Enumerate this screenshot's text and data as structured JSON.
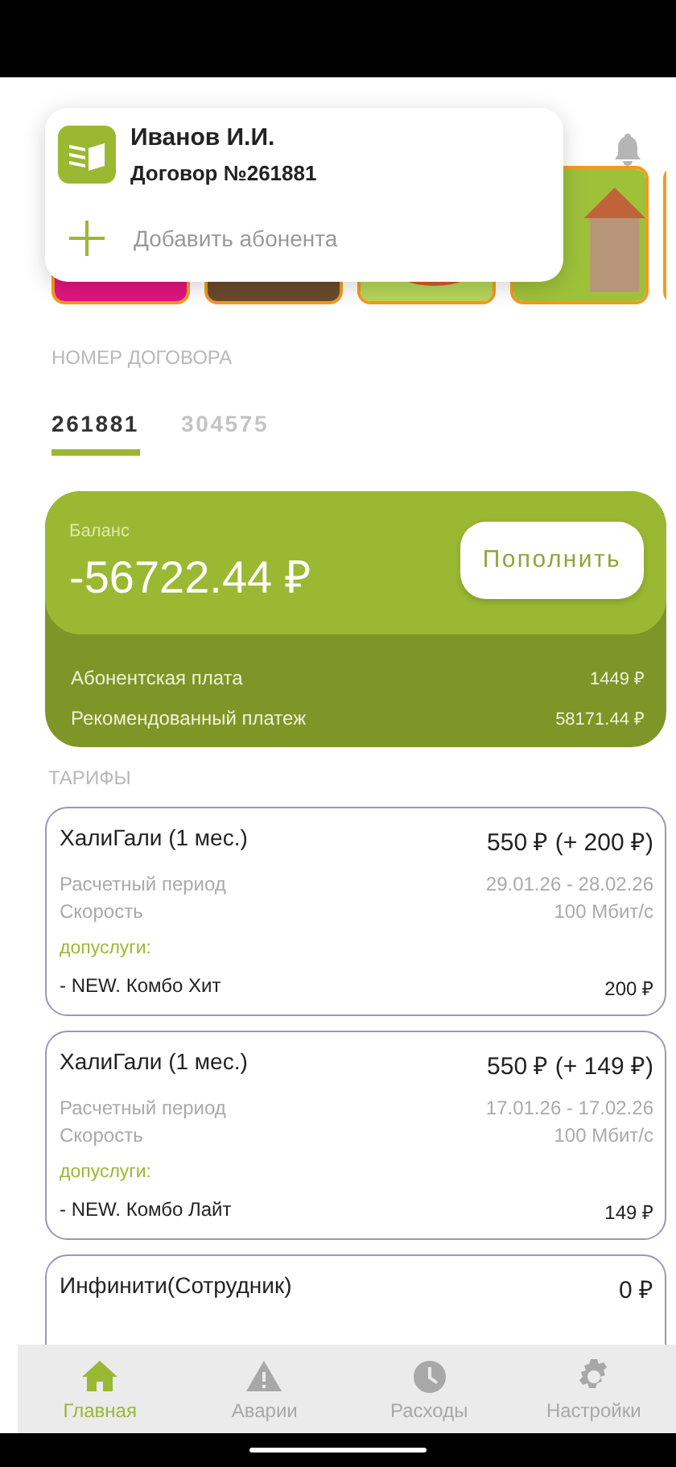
{
  "popup": {
    "name": "Иванов И.И.",
    "contract": "Договор №261881",
    "add_label": "Добавить абонента"
  },
  "contract_section": {
    "label": "НОМЕР ДОГОВОРА",
    "tabs": [
      {
        "label": "261881",
        "selected": true
      },
      {
        "label": "304575",
        "selected": false
      }
    ]
  },
  "balance": {
    "label": "Баланс",
    "amount": "-56722.44 ₽",
    "button": "Пополнить",
    "rows": [
      {
        "label": "Абонентская плата",
        "value": "1449 ₽"
      },
      {
        "label": "Рекомендованный платеж",
        "value": "58171.44 ₽"
      }
    ]
  },
  "tariffs": {
    "title": "ТАРИФЫ",
    "items": [
      {
        "name": "ХалиГали (1 мес.)",
        "price": "550 ₽ (+ 200 ₽)",
        "details": [
          {
            "label": "Расчетный период",
            "value": "29.01.26 - 28.02.26"
          },
          {
            "label": "Скорость",
            "value": "100 Мбит/с"
          }
        ],
        "extras_label": "допуслуги:",
        "extras": [
          {
            "name": "- NEW. Комбо Хит",
            "price": "200 ₽"
          }
        ]
      },
      {
        "name": "ХалиГали (1 мес.)",
        "price": "550 ₽ (+ 149 ₽)",
        "details": [
          {
            "label": "Расчетный период",
            "value": "17.01.26 - 17.02.26"
          },
          {
            "label": "Скорость",
            "value": "100 Мбит/с"
          }
        ],
        "extras_label": "допуслуги:",
        "extras": [
          {
            "name": "- NEW. Комбо Лайт",
            "price": "149 ₽"
          }
        ]
      },
      {
        "name": "Инфинити(Сотрудник)",
        "price": "0 ₽"
      }
    ]
  },
  "nav": [
    {
      "label": "Главная",
      "selected": true
    },
    {
      "label": "Аварии",
      "selected": false
    },
    {
      "label": "Расходы",
      "selected": false
    },
    {
      "label": "Настройки",
      "selected": false
    }
  ]
}
